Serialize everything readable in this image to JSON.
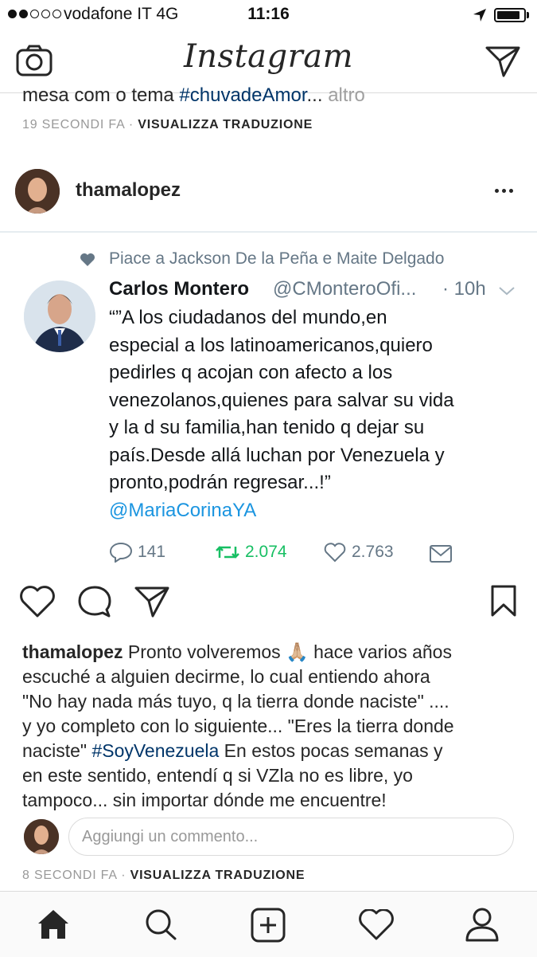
{
  "status_bar": {
    "carrier": "vodafone IT   4G",
    "time": "11:16"
  },
  "header": {
    "app_name": "Instagram",
    "icons": [
      "camera-icon",
      "direct-message-icon"
    ]
  },
  "previous_post": {
    "caption_start": "mesa com o tema ",
    "hashtag": "#chuvadeAmor",
    "ellipsis": "...",
    "more": " altro",
    "time": "19 SECONDI FA",
    "separator": " · ",
    "translate": "VISUALIZZA TRADUZIONE"
  },
  "post": {
    "username": "thamalopez",
    "menu_icon": "more-options-icon"
  },
  "tweet": {
    "liked_by": "Piace a Jackson De la Peña e Maite Delgado",
    "name": "Carlos Montero",
    "handle": "@CMonteroOfi...",
    "time": "· 10h",
    "text_lines": [
      "“”A los ciudadanos del mundo,en",
      "especial a los latinoamericanos,quiero",
      "pedirles q acojan con afecto a los",
      "venezolanos,quienes para salvar su vida",
      "y la d su familia,han tenido q dejar su",
      "país.Desde allá luchan por Venezuela y",
      "pronto,podrán regresar...!”"
    ],
    "mention": "@MariaCorinaYA",
    "replies": "141",
    "retweets": "2.074",
    "likes": "2.763",
    "accent_color": "#1b95e0",
    "retweet_color": "#17bf63"
  },
  "caption": {
    "username": "thamalopez",
    "line1": " Pronto volveremos ",
    "line1_end": " hace varios años",
    "line2": "escuché a alguien decirme, lo cual entiendo ahora",
    "line3": "\"No hay nada más tuyo, q la tierra donde naciste\" ....",
    "line4": "y yo completo con lo siguiente... \"Eres la tierra donde",
    "line5_start": "naciste\" ",
    "hashtag": "#SoyVenezuela",
    "line5_end": "  En estos pocas semanas y",
    "line6": "en este sentido, entendí q si VZla no es libre, yo",
    "line7": "tampoco... sin importar dónde me encuentre!",
    "emoji": "🙏🏼"
  },
  "comment": {
    "placeholder": "Aggiungi un commento..."
  },
  "post_meta": {
    "time": "8 SECONDI FA",
    "separator": " · ",
    "translate": "VISUALIZZA TRADUZIONE"
  },
  "tab_bar": {
    "icons": [
      "home-icon",
      "search-icon",
      "add-post-icon",
      "activity-heart-icon",
      "profile-icon"
    ]
  }
}
